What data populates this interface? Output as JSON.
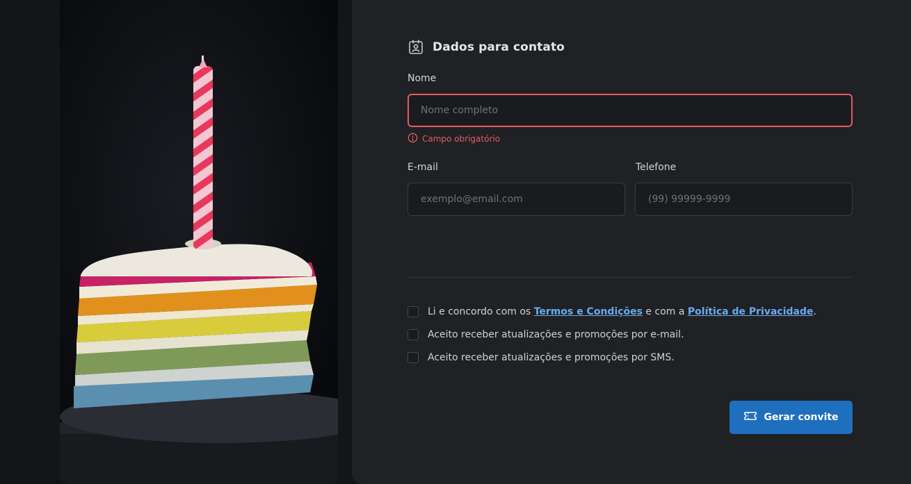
{
  "section": {
    "title": "Dados para contato",
    "icon": "contact-card-icon"
  },
  "fields": {
    "name": {
      "label": "Nome",
      "value": "",
      "placeholder": "Nome completo",
      "error": "Campo obrigatório"
    },
    "email": {
      "label": "E-mail",
      "value": "",
      "placeholder": "exemplo@email.com"
    },
    "phone": {
      "label": "Telefone",
      "value": "",
      "placeholder": "(99) 99999-9999"
    }
  },
  "consents": {
    "terms": {
      "prefix": "Li e concordo com os ",
      "terms_link": "Termos e Condições",
      "middle": " e com a ",
      "privacy_link": "Política de Privacidade",
      "suffix": ".",
      "checked": false
    },
    "email_updates": {
      "label": "Aceito receber atualizações e promoções por e-mail.",
      "checked": false
    },
    "sms_updates": {
      "label": "Aceito receber atualizações e promoções por SMS.",
      "checked": false
    }
  },
  "submit": {
    "label": "Gerar convite",
    "icon": "ticket-icon"
  },
  "colors": {
    "accent": "#1f6fbf",
    "error": "#e35d5d",
    "link": "#6aaaf0",
    "panel": "#1f2124",
    "background": "#141517"
  },
  "image": {
    "subject": "rainbow-cake-slice-with-candle"
  }
}
